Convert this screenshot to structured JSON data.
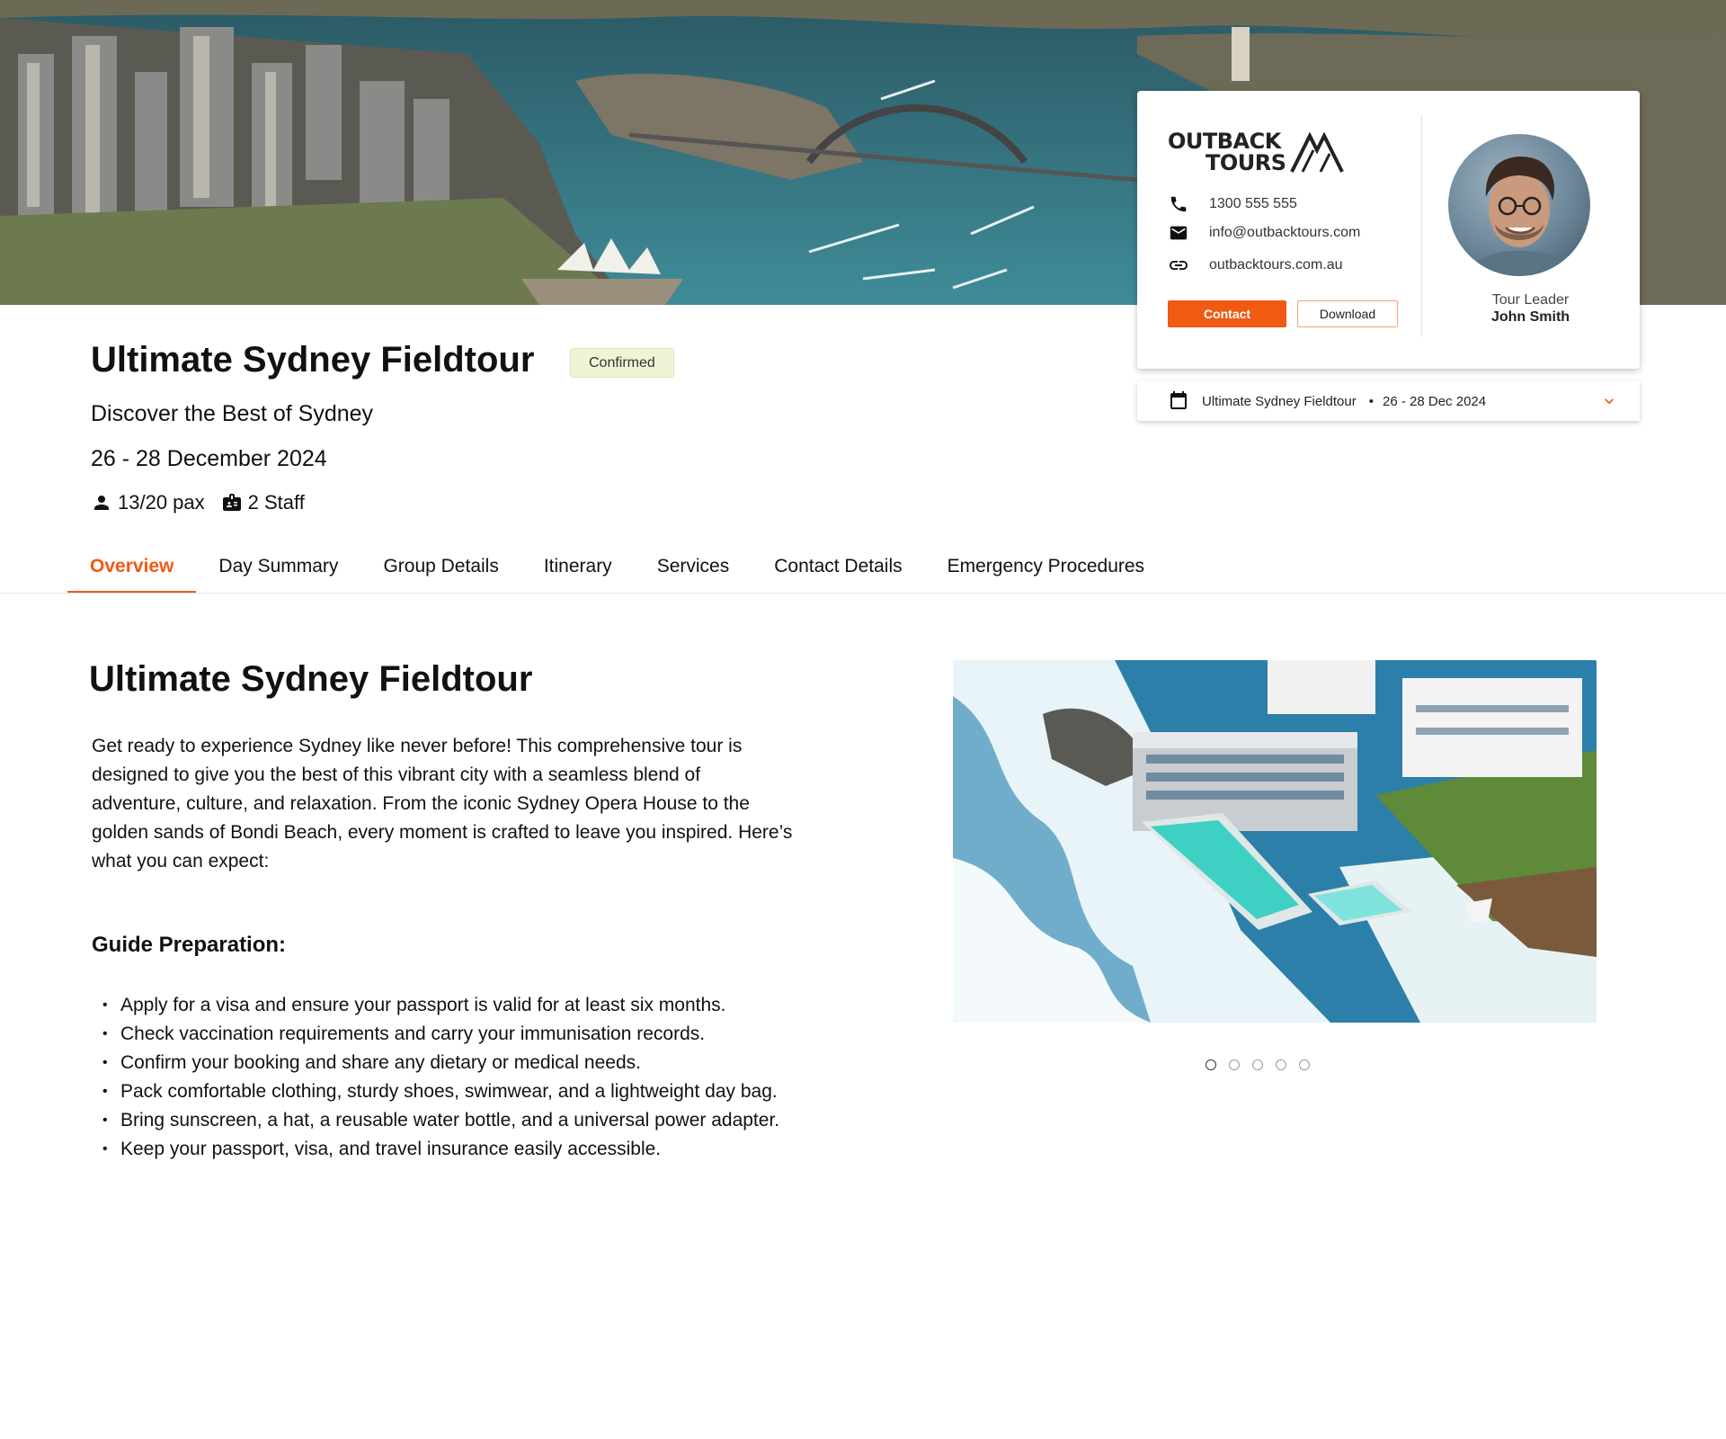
{
  "hero": {
    "alt": "Sydney Harbour aerial"
  },
  "contact_card": {
    "brand_line1": "OUTBACK",
    "brand_line2": "TOURS",
    "phone": "1300 555 555",
    "email": "info@outbacktours.com",
    "website": "outbacktours.com.au",
    "contact_label": "Contact",
    "download_label": "Download",
    "leader_role": "Tour Leader",
    "leader_name": "John Smith"
  },
  "tour_select": {
    "name": "Ultimate Sydney Fieldtour",
    "separator": "•",
    "dates": "26 - 28 Dec 2024"
  },
  "header": {
    "title": "Ultimate Sydney Fieldtour",
    "status": "Confirmed",
    "subtitle": "Discover the Best of Sydney",
    "dates": "26 - 28 December 2024",
    "pax": "13/20 pax",
    "staff": "2 Staff"
  },
  "tabs": [
    {
      "label": "Overview",
      "active": true
    },
    {
      "label": "Day Summary"
    },
    {
      "label": "Group Details"
    },
    {
      "label": "Itinerary"
    },
    {
      "label": "Services"
    },
    {
      "label": "Contact Details"
    },
    {
      "label": "Emergency Procedures"
    }
  ],
  "overview": {
    "title": "Ultimate Sydney Fieldtour",
    "intro": "Get ready to experience Sydney like never before! This comprehensive tour is designed to give you the best of this vibrant city with a seamless blend of adventure, culture, and relaxation. From the iconic Sydney Opera House to the golden sands of Bondi Beach, every moment is crafted to leave you inspired. Here’s what you can expect:",
    "prep_title": "Guide Preparation:",
    "prep_items": [
      "Apply for a visa and ensure your passport is valid for at least six months.",
      "Check vaccination requirements and carry your immunisation records.",
      "Confirm your booking and share any dietary or medical needs.",
      "Pack comfortable clothing, sturdy shoes, swimwear, and a lightweight day bag.",
      "Bring sunscreen, a hat, a reusable water bottle, and a universal power adapter.",
      "Keep your passport, visa, and travel insurance easily accessible."
    ]
  },
  "gallery": {
    "count": 5,
    "current": 1
  },
  "colors": {
    "accent": "#f05a13",
    "badge_bg": "#eef5d4"
  },
  "icons": [
    "phone-icon",
    "mail-icon",
    "link-icon",
    "calendar-icon",
    "chevron-down-icon",
    "person-icon",
    "badge-icon"
  ]
}
